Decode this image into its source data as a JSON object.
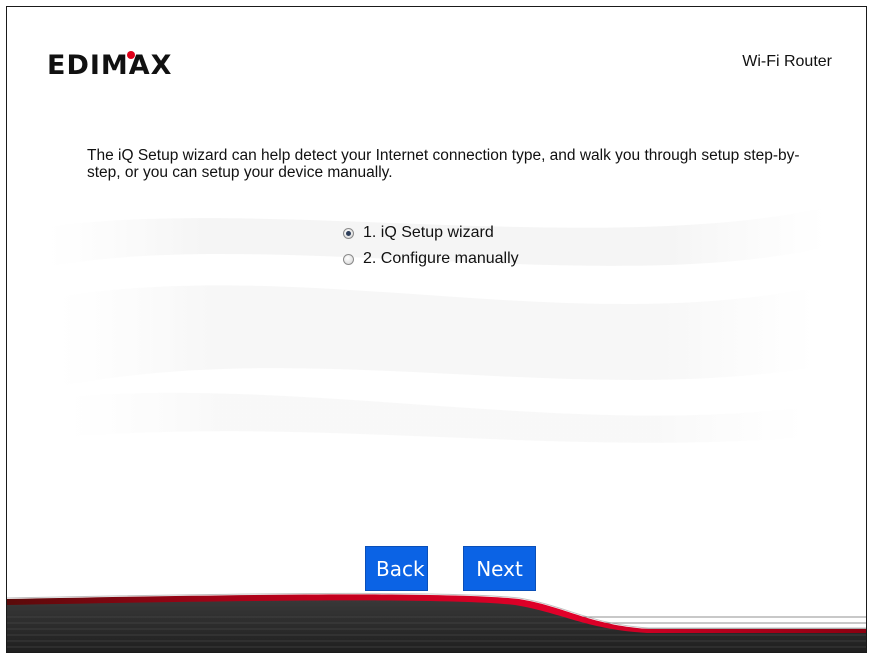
{
  "header": {
    "logo_text": "EDIMAX",
    "product_name": "Wi-Fi Router"
  },
  "main": {
    "intro_text": "The iQ Setup wizard can help detect your Internet connection type, and walk you through setup step-by-step, or you can setup your device manually.",
    "options": [
      {
        "label": "1. iQ Setup wizard",
        "selected": true
      },
      {
        "label": "2. Configure manually",
        "selected": false
      }
    ]
  },
  "buttons": {
    "back_label": "Back",
    "next_label": "Next"
  },
  "colors": {
    "button_blue": "#0b63e5",
    "logo_dot_red": "#e0001a",
    "footer_dark": "#2b2b2b",
    "footer_red_stripe": "#b3001b"
  },
  "icons": {
    "logo_dot": "red-dot-icon",
    "radio": "radio-button-icon"
  }
}
